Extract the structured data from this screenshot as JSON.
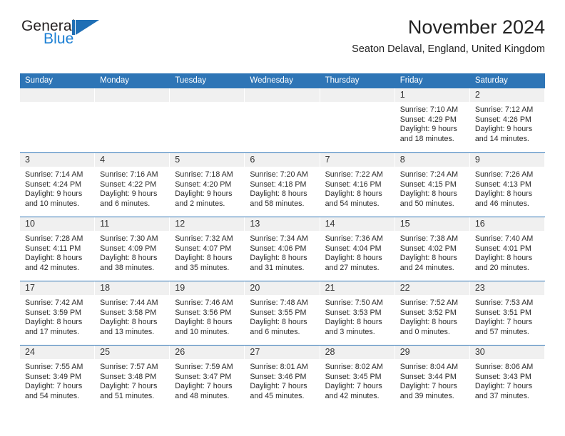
{
  "brand": {
    "line1": "General",
    "line2": "Blue",
    "mark_icon": "general-blue-triangle-logo"
  },
  "header": {
    "title": "November 2024",
    "location": "Seaton Delaval, England, United Kingdom"
  },
  "colors": {
    "header_blue": "#2E75B6",
    "brand_blue": "#1B7FD4",
    "day_band": "#F0F0F0"
  },
  "weekdays": [
    "Sunday",
    "Monday",
    "Tuesday",
    "Wednesday",
    "Thursday",
    "Friday",
    "Saturday"
  ],
  "weeks": [
    [
      {
        "day": "",
        "lines": []
      },
      {
        "day": "",
        "lines": []
      },
      {
        "day": "",
        "lines": []
      },
      {
        "day": "",
        "lines": []
      },
      {
        "day": "",
        "lines": []
      },
      {
        "day": "1",
        "lines": [
          "Sunrise: 7:10 AM",
          "Sunset: 4:29 PM",
          "Daylight: 9 hours",
          "and 18 minutes."
        ]
      },
      {
        "day": "2",
        "lines": [
          "Sunrise: 7:12 AM",
          "Sunset: 4:26 PM",
          "Daylight: 9 hours",
          "and 14 minutes."
        ]
      }
    ],
    [
      {
        "day": "3",
        "lines": [
          "Sunrise: 7:14 AM",
          "Sunset: 4:24 PM",
          "Daylight: 9 hours",
          "and 10 minutes."
        ]
      },
      {
        "day": "4",
        "lines": [
          "Sunrise: 7:16 AM",
          "Sunset: 4:22 PM",
          "Daylight: 9 hours",
          "and 6 minutes."
        ]
      },
      {
        "day": "5",
        "lines": [
          "Sunrise: 7:18 AM",
          "Sunset: 4:20 PM",
          "Daylight: 9 hours",
          "and 2 minutes."
        ]
      },
      {
        "day": "6",
        "lines": [
          "Sunrise: 7:20 AM",
          "Sunset: 4:18 PM",
          "Daylight: 8 hours",
          "and 58 minutes."
        ]
      },
      {
        "day": "7",
        "lines": [
          "Sunrise: 7:22 AM",
          "Sunset: 4:16 PM",
          "Daylight: 8 hours",
          "and 54 minutes."
        ]
      },
      {
        "day": "8",
        "lines": [
          "Sunrise: 7:24 AM",
          "Sunset: 4:15 PM",
          "Daylight: 8 hours",
          "and 50 minutes."
        ]
      },
      {
        "day": "9",
        "lines": [
          "Sunrise: 7:26 AM",
          "Sunset: 4:13 PM",
          "Daylight: 8 hours",
          "and 46 minutes."
        ]
      }
    ],
    [
      {
        "day": "10",
        "lines": [
          "Sunrise: 7:28 AM",
          "Sunset: 4:11 PM",
          "Daylight: 8 hours",
          "and 42 minutes."
        ]
      },
      {
        "day": "11",
        "lines": [
          "Sunrise: 7:30 AM",
          "Sunset: 4:09 PM",
          "Daylight: 8 hours",
          "and 38 minutes."
        ]
      },
      {
        "day": "12",
        "lines": [
          "Sunrise: 7:32 AM",
          "Sunset: 4:07 PM",
          "Daylight: 8 hours",
          "and 35 minutes."
        ]
      },
      {
        "day": "13",
        "lines": [
          "Sunrise: 7:34 AM",
          "Sunset: 4:06 PM",
          "Daylight: 8 hours",
          "and 31 minutes."
        ]
      },
      {
        "day": "14",
        "lines": [
          "Sunrise: 7:36 AM",
          "Sunset: 4:04 PM",
          "Daylight: 8 hours",
          "and 27 minutes."
        ]
      },
      {
        "day": "15",
        "lines": [
          "Sunrise: 7:38 AM",
          "Sunset: 4:02 PM",
          "Daylight: 8 hours",
          "and 24 minutes."
        ]
      },
      {
        "day": "16",
        "lines": [
          "Sunrise: 7:40 AM",
          "Sunset: 4:01 PM",
          "Daylight: 8 hours",
          "and 20 minutes."
        ]
      }
    ],
    [
      {
        "day": "17",
        "lines": [
          "Sunrise: 7:42 AM",
          "Sunset: 3:59 PM",
          "Daylight: 8 hours",
          "and 17 minutes."
        ]
      },
      {
        "day": "18",
        "lines": [
          "Sunrise: 7:44 AM",
          "Sunset: 3:58 PM",
          "Daylight: 8 hours",
          "and 13 minutes."
        ]
      },
      {
        "day": "19",
        "lines": [
          "Sunrise: 7:46 AM",
          "Sunset: 3:56 PM",
          "Daylight: 8 hours",
          "and 10 minutes."
        ]
      },
      {
        "day": "20",
        "lines": [
          "Sunrise: 7:48 AM",
          "Sunset: 3:55 PM",
          "Daylight: 8 hours",
          "and 6 minutes."
        ]
      },
      {
        "day": "21",
        "lines": [
          "Sunrise: 7:50 AM",
          "Sunset: 3:53 PM",
          "Daylight: 8 hours",
          "and 3 minutes."
        ]
      },
      {
        "day": "22",
        "lines": [
          "Sunrise: 7:52 AM",
          "Sunset: 3:52 PM",
          "Daylight: 8 hours",
          "and 0 minutes."
        ]
      },
      {
        "day": "23",
        "lines": [
          "Sunrise: 7:53 AM",
          "Sunset: 3:51 PM",
          "Daylight: 7 hours",
          "and 57 minutes."
        ]
      }
    ],
    [
      {
        "day": "24",
        "lines": [
          "Sunrise: 7:55 AM",
          "Sunset: 3:49 PM",
          "Daylight: 7 hours",
          "and 54 minutes."
        ]
      },
      {
        "day": "25",
        "lines": [
          "Sunrise: 7:57 AM",
          "Sunset: 3:48 PM",
          "Daylight: 7 hours",
          "and 51 minutes."
        ]
      },
      {
        "day": "26",
        "lines": [
          "Sunrise: 7:59 AM",
          "Sunset: 3:47 PM",
          "Daylight: 7 hours",
          "and 48 minutes."
        ]
      },
      {
        "day": "27",
        "lines": [
          "Sunrise: 8:01 AM",
          "Sunset: 3:46 PM",
          "Daylight: 7 hours",
          "and 45 minutes."
        ]
      },
      {
        "day": "28",
        "lines": [
          "Sunrise: 8:02 AM",
          "Sunset: 3:45 PM",
          "Daylight: 7 hours",
          "and 42 minutes."
        ]
      },
      {
        "day": "29",
        "lines": [
          "Sunrise: 8:04 AM",
          "Sunset: 3:44 PM",
          "Daylight: 7 hours",
          "and 39 minutes."
        ]
      },
      {
        "day": "30",
        "lines": [
          "Sunrise: 8:06 AM",
          "Sunset: 3:43 PM",
          "Daylight: 7 hours",
          "and 37 minutes."
        ]
      }
    ]
  ]
}
